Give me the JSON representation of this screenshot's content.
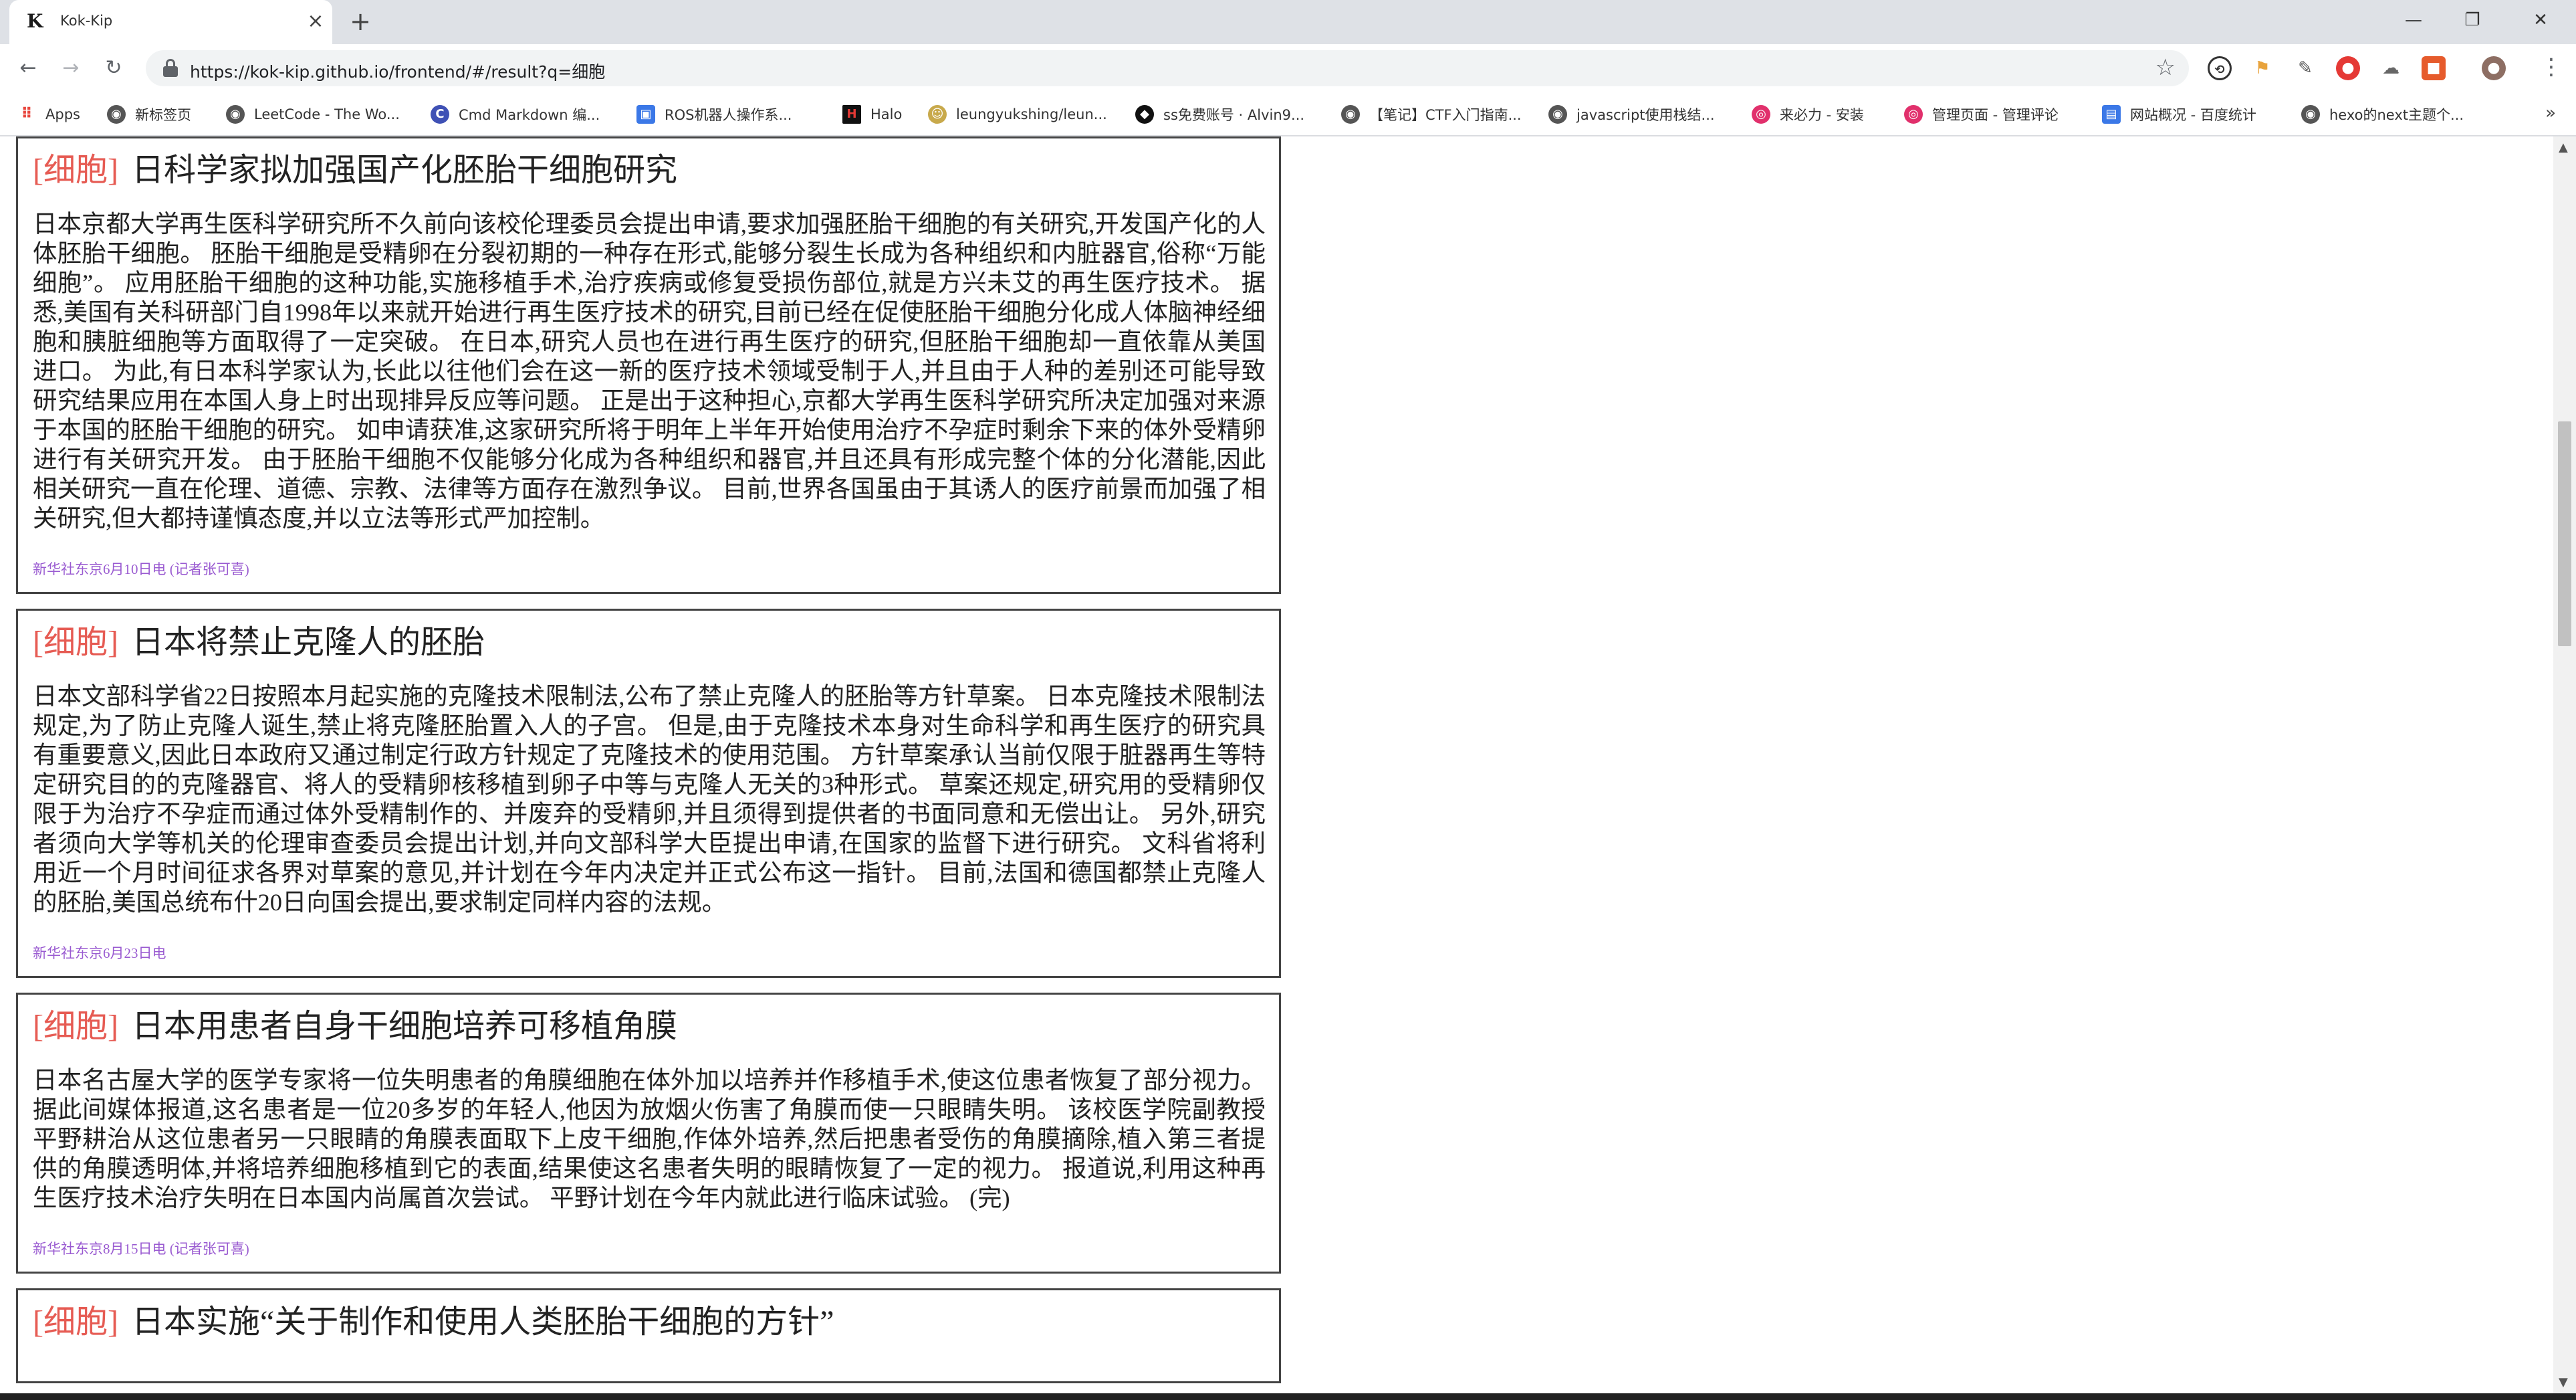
{
  "browser": {
    "tab": {
      "title": "Kok-Kip",
      "favicon": "K"
    },
    "url": "https://kok-kip.github.io/frontend/#/result?q=细胞",
    "window_controls": {
      "minimize": "—",
      "restore": "❐",
      "close": "✕"
    },
    "bookmarks": [
      {
        "label": "Apps",
        "icon": "apps-grid-icon",
        "color": "#e8453c"
      },
      {
        "label": "新标签页",
        "icon": "globe-icon",
        "color": "#555555"
      },
      {
        "label": "LeetCode - The Wo...",
        "icon": "globe-icon",
        "color": "#555555"
      },
      {
        "label": "Cmd Markdown 编...",
        "icon": "cmd-markdown-icon",
        "color": "#3f51b5"
      },
      {
        "label": "ROS机器人操作系...",
        "icon": "ros-icon",
        "color": "#3b78e7"
      },
      {
        "label": "Halo",
        "icon": "halo-icon",
        "color": "#111111"
      },
      {
        "label": "leungyukshing/leun...",
        "icon": "avatar-icon",
        "color": "#c8a94b"
      },
      {
        "label": "ss免费账号 · Alvin9...",
        "icon": "github-icon",
        "color": "#111111"
      },
      {
        "label": "【笔记】CTF入门指南...",
        "icon": "globe-icon",
        "color": "#555555"
      },
      {
        "label": "javascript使用栈结...",
        "icon": "globe-icon",
        "color": "#555555"
      },
      {
        "label": "来必力 - 安装",
        "icon": "livere-icon",
        "color": "#e1306c"
      },
      {
        "label": "管理页面 - 管理评论",
        "icon": "livere-icon",
        "color": "#e1306c"
      },
      {
        "label": "网站概况 - 百度统计",
        "icon": "baidu-stats-icon",
        "color": "#3b78e7"
      },
      {
        "label": "hexo的next主题个...",
        "icon": "globe-icon",
        "color": "#555555"
      }
    ],
    "bookmarks_more": "»"
  },
  "results": [
    {
      "tag": "[细胞]",
      "title": "日科学家拟加强国产化胚胎干细胞研究",
      "body": "日本京都大学再生医科学研究所不久前向该校伦理委员会提出申请,要求加强胚胎干细胞的有关研究,开发国产化的人体胚胎干细胞。 胚胎干细胞是受精卵在分裂初期的一种存在形式,能够分裂生长成为各种组织和内脏器官,俗称“万能细胞”。 应用胚胎干细胞的这种功能,实施移植手术,治疗疾病或修复受损伤部位,就是方兴未艾的再生医疗技术。 据悉,美国有关科研部门自1998年以来就开始进行再生医疗技术的研究,目前已经在促使胚胎干细胞分化成人体脑神经细胞和胰脏细胞等方面取得了一定突破。 在日本,研究人员也在进行再生医疗的研究,但胚胎干细胞却一直依靠从美国进口。 为此,有日本科学家认为,长此以往他们会在这一新的医疗技术领域受制于人,并且由于人种的差别还可能导致研究结果应用在本国人身上时出现排异反应等问题。 正是出于这种担心,京都大学再生医科学研究所决定加强对来源于本国的胚胎干细胞的研究。 如申请获准,这家研究所将于明年上半年开始使用治疗不孕症时剩余下来的体外受精卵进行有关研究开发。 由于胚胎干细胞不仅能够分化成为各种组织和器官,并且还具有形成完整个体的分化潜能,因此相关研究一直在伦理、道德、宗教、法律等方面存在激烈争议。 目前,世界各国虽由于其诱人的医疗前景而加强了相关研究,但大都持谨慎态度,并以立法等形式严加控制。",
      "meta": "新华社东京6月10日电 (记者张可喜)"
    },
    {
      "tag": "[细胞]",
      "title": "日本将禁止克隆人的胚胎",
      "body": "日本文部科学省22日按照本月起实施的克隆技术限制法,公布了禁止克隆人的胚胎等方针草案。 日本克隆技术限制法规定,为了防止克隆人诞生,禁止将克隆胚胎置入人的子宫。 但是,由于克隆技术本身对生命科学和再生医疗的研究具有重要意义,因此日本政府又通过制定行政方针规定了克隆技术的使用范围。 方针草案承认当前仅限于脏器再生等特定研究目的的克隆器官、将人的受精卵核移植到卵子中等与克隆人无关的3种形式。 草案还规定,研究用的受精卵仅限于为治疗不孕症而通过体外受精制作的、并废弃的受精卵,并且须得到提供者的书面同意和无偿出让。 另外,研究者须向大学等机关的伦理审查委员会提出计划,并向文部科学大臣提出申请,在国家的监督下进行研究。 文科省将利用近一个月时间征求各界对草案的意见,并计划在今年内决定并正式公布这一指针。 目前,法国和德国都禁止克隆人的胚胎,美国总统布什20日向国会提出,要求制定同样内容的法规。",
      "meta": "新华社东京6月23日电"
    },
    {
      "tag": "[细胞]",
      "title": "日本用患者自身干细胞培养可移植角膜",
      "body": "日本名古屋大学的医学专家将一位失明患者的角膜细胞在体外加以培养并作移植手术,使这位患者恢复了部分视力。 据此间媒体报道,这名患者是一位20多岁的年轻人,他因为放烟火伤害了角膜而使一只眼睛失明。 该校医学院副教授平野耕治从这位患者另一只眼睛的角膜表面取下上皮干细胞,作体外培养,然后把患者受伤的角膜摘除,植入第三者提供的角膜透明体,并将培养细胞移植到它的表面,结果使这名患者失明的眼睛恢复了一定的视力。 报道说,利用这种再生医疗技术治疗失明在日本国内尚属首次尝试。 平野计划在今年内就此进行临床试验。 (完)",
      "meta": "新华社东京8月15日电 (记者张可喜)"
    },
    {
      "tag": "[细胞]",
      "title": "日本实施“关于制作和使用人类胚胎干细胞的方针”",
      "body": "",
      "meta": ""
    }
  ]
}
